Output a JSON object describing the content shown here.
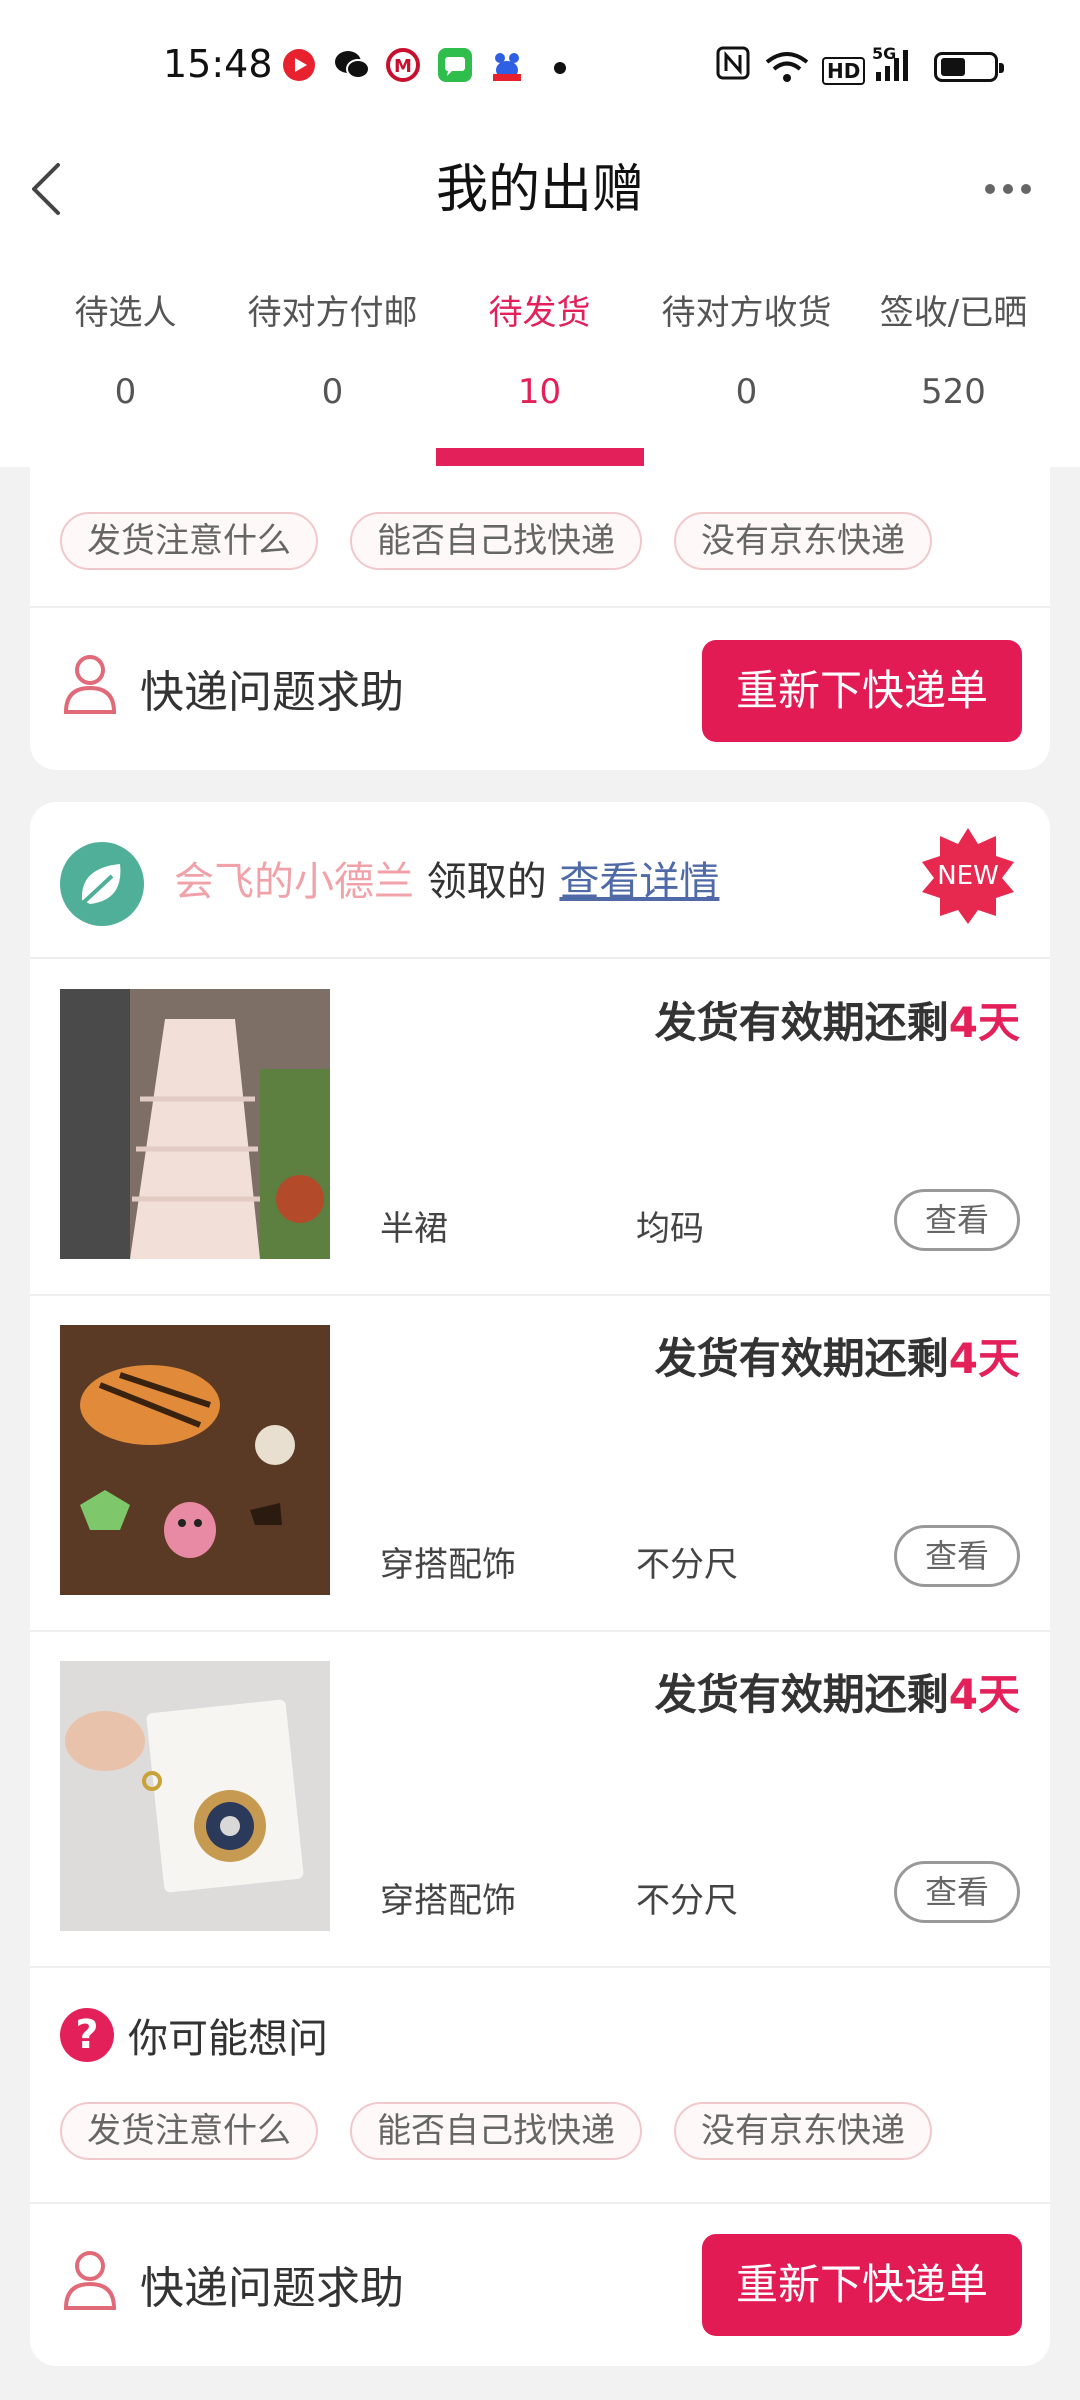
{
  "status_bar": {
    "time": "15:48",
    "net": "5G",
    "hd": "HD",
    "left_icons": [
      "video-app-icon",
      "wechat-icon",
      "metro-icon",
      "messages-icon",
      "baidu-icon"
    ],
    "right_icons": [
      "nfc-icon",
      "wifi-icon",
      "hd-icon",
      "signal-icon",
      "battery-icon"
    ]
  },
  "header": {
    "title": "我的出赠"
  },
  "tabs": [
    {
      "label": "待选人",
      "count": "0"
    },
    {
      "label": "待对方付邮",
      "count": "0"
    },
    {
      "label": "待发货",
      "count": "10"
    },
    {
      "label": "待对方收货",
      "count": "0"
    },
    {
      "label": "签收/已晒",
      "count": "520"
    }
  ],
  "active_tab_index": 2,
  "faq": {
    "title": "你可能想问",
    "chips": [
      "发货注意什么",
      "能否自己找快递",
      "没有京东快递"
    ]
  },
  "help": {
    "label": "快递问题求助",
    "button": "重新下快递单"
  },
  "order": {
    "giver_name": "会飞的小德兰",
    "claimed_text": "领取的",
    "detail_link": "查看详情",
    "new_badge": "NEW",
    "items": [
      {
        "deadline_prefix": "发货有效期还剩",
        "days": "4天",
        "name": "半裙",
        "size": "均码",
        "view": "查看"
      },
      {
        "deadline_prefix": "发货有效期还剩",
        "days": "4天",
        "name": "穿搭配饰",
        "size": "不分尺",
        "view": "查看"
      },
      {
        "deadline_prefix": "发货有效期还剩",
        "days": "4天",
        "name": "穿搭配饰",
        "size": "不分尺",
        "view": "查看"
      }
    ]
  },
  "colors": {
    "accent": "#e3205a",
    "button": "#e31b55",
    "link": "#4f6aa6",
    "giver": "#f0a2a8"
  }
}
